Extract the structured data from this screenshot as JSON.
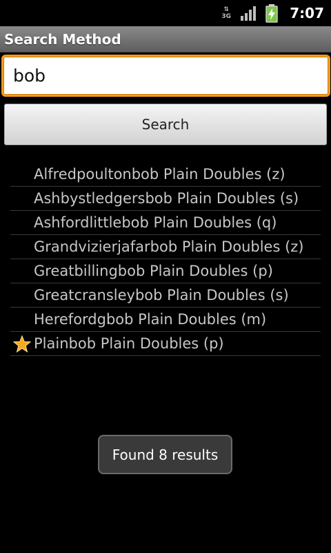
{
  "status_bar": {
    "network_label": "3G",
    "time": "7:07",
    "icons": [
      "network-3g-icon",
      "signal-icon",
      "battery-charging-icon"
    ]
  },
  "title_bar": {
    "title": "Search Method"
  },
  "search": {
    "value": "bob",
    "button_label": "Search"
  },
  "results": [
    {
      "label": "Alfredpoultonbob Plain Doubles (z)",
      "starred": false
    },
    {
      "label": "Ashbystledgersbob Plain Doubles (s)",
      "starred": false
    },
    {
      "label": "Ashfordlittlebob Plain Doubles (q)",
      "starred": false
    },
    {
      "label": "Grandvizierjafarbob Plain Doubles (z)",
      "starred": false
    },
    {
      "label": "Greatbillingbob Plain Doubles (p)",
      "starred": false
    },
    {
      "label": "Greatcransleybob Plain Doubles (s)",
      "starred": false
    },
    {
      "label": "Herefordgbob Plain Doubles (m)",
      "starred": false
    },
    {
      "label": "Plainbob Plain Doubles (p)",
      "starred": true
    }
  ],
  "toast": {
    "message": "Found 8 results"
  },
  "colors": {
    "accent": "#f29a1f",
    "star": "#f7a81c"
  }
}
